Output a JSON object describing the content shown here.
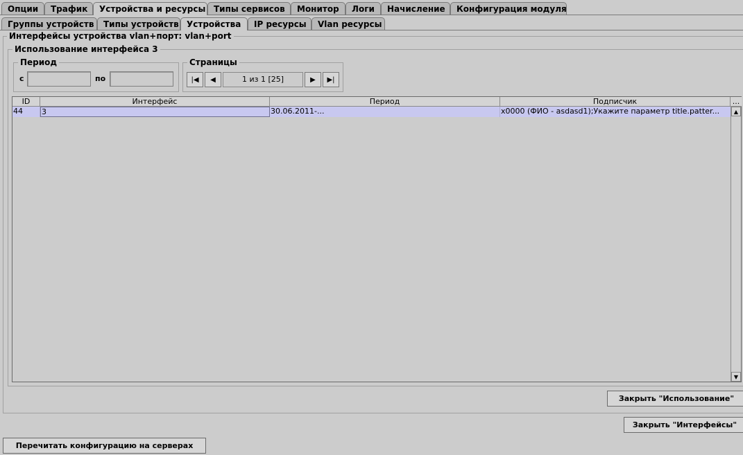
{
  "main_tabs": [
    "Опции",
    "Трафик",
    "Устройства и ресурсы",
    "Типы сервисов",
    "Монитор",
    "Логи",
    "Начисление",
    "Конфигурация модуля"
  ],
  "sub_tabs": [
    "Группы устройств",
    "Типы устройств",
    "Устройства",
    "IP ресурсы",
    "Vlan ресурсы"
  ],
  "interfaces_group_title": "Интерфейсы устройства vlan+порт: vlan+port",
  "usage_group_title": "Использование интерфейса 3",
  "period": {
    "title": "Период",
    "from_label": "с",
    "to_label": "по",
    "from_value": "",
    "to_value": ""
  },
  "pages": {
    "title": "Страницы",
    "info": "1 из 1 [25]"
  },
  "table": {
    "columns": [
      "ID",
      "Интерфейс",
      "Период",
      "Подписчик",
      "..."
    ],
    "rows": [
      [
        "44",
        "3",
        "30.06.2011-...",
        "x0000 (ФИО - asdasd1);Укажите параметр title.patter..."
      ]
    ]
  },
  "buttons": {
    "close_usage": "Закрыть \"Использование\"",
    "close_interfaces": "Закрыть \"Интерфейсы\"",
    "reread_config": "Перечитать конфигурацию на серверах"
  }
}
